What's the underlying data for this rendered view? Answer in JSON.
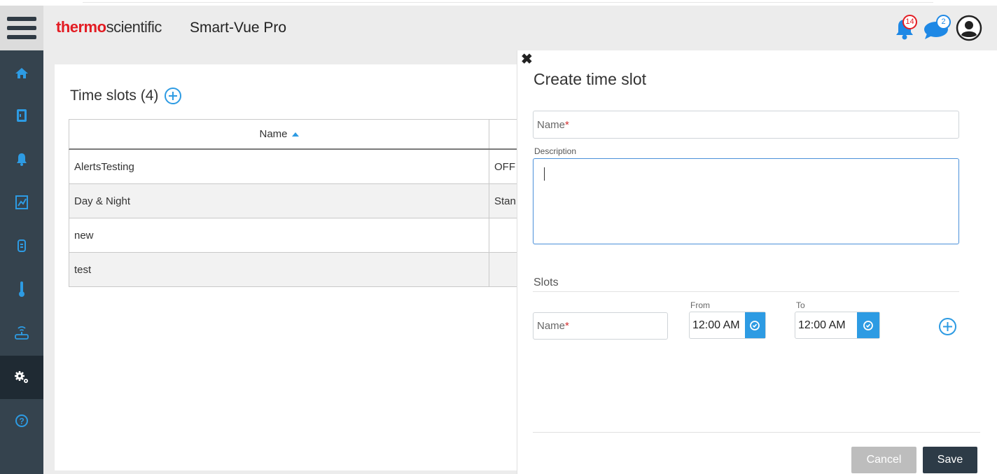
{
  "header": {
    "logo_bold": "thermo",
    "logo_regular": "scientific",
    "app_title": "Smart-Vue Pro",
    "notifications_count": "14",
    "messages_count": "2"
  },
  "sidebar": {
    "items": [
      "home-icon",
      "door-icon",
      "bell-icon",
      "report-icon",
      "sensor-icon",
      "thermometer-icon",
      "wireless-icon",
      "settings-icon",
      "help-icon"
    ],
    "active_index": 7
  },
  "main": {
    "title": "Time slots (4)",
    "table": {
      "column_name": "Name",
      "rows": [
        {
          "name": "AlertsTesting",
          "second": "OFF"
        },
        {
          "name": "Day & Night",
          "second": "Stan"
        },
        {
          "name": "new",
          "second": ""
        },
        {
          "name": "test",
          "second": ""
        }
      ]
    }
  },
  "panel": {
    "title": "Create time slot",
    "name_placeholder": "Name",
    "required_mark": "*",
    "description_label": "Description",
    "slots_label": "Slots",
    "slot_name_placeholder": "Name",
    "from_label": "From",
    "to_label": "To",
    "from_value": "12:00 AM",
    "to_value": "12:00 AM",
    "cancel_label": "Cancel",
    "save_label": "Save"
  },
  "colors": {
    "accent_blue": "#2d9be3",
    "brand_red": "#e31c23",
    "sidebar_bg": "#35434e"
  }
}
